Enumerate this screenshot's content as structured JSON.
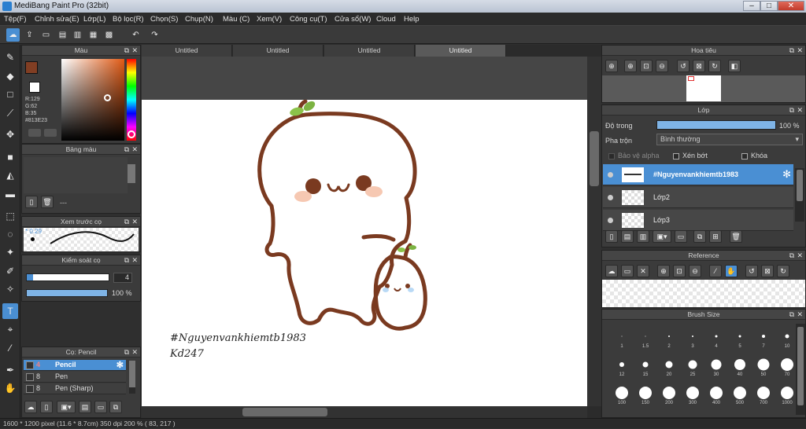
{
  "window": {
    "title": "MediBang Paint Pro (32bit)",
    "minimize": "–",
    "maximize": "□",
    "close": "✕"
  },
  "menu": [
    "Tệp(F)",
    "Chỉnh sửa(E)",
    "Lớp(L)",
    "Bộ lọc(R)",
    "Chọn(S)",
    "Chụp(N)",
    "Màu (C)",
    "Xem(V)",
    "Công cụ(T)",
    "Cửa sổ(W)",
    "Cloud",
    "Help"
  ],
  "tabs": [
    "Untitled",
    "Untitled",
    "Untitled",
    "Untitled"
  ],
  "color_panel": {
    "title": "Màu",
    "r": "R:129",
    "g": "G:62",
    "b": "B:35",
    "hex": "#813E23",
    "main_color": "#813E23"
  },
  "palette_panel": {
    "title": "Bảng màu",
    "dash": "---"
  },
  "brush_preview": {
    "title": "Xem trước cọ",
    "size_label": "0.29"
  },
  "brush_control": {
    "title": "Kiểm soát cọ",
    "size_value": "4",
    "opacity_value": "100 %",
    "size_fraction": 0.08,
    "opacity_fraction": 1.0
  },
  "brush_list": {
    "title": "Cọ: Pencil",
    "items": [
      {
        "size": "4",
        "name": "Pencil",
        "selected": true
      },
      {
        "size": "8",
        "name": "Pen",
        "selected": false
      },
      {
        "size": "8",
        "name": "Pen (Sharp)",
        "selected": false
      }
    ]
  },
  "canvas": {
    "watermark_line1": "#Nguyenvankhiemtb1983",
    "watermark_line2": "Kd247"
  },
  "navigator": {
    "title": "Hoa tiêu"
  },
  "layers": {
    "title": "Lớp",
    "opacity_label": "Độ trong",
    "opacity_value": "100 %",
    "opacity_fraction": 1.0,
    "blend_label": "Pha trộn",
    "blend_value": "Bình thường",
    "protect_alpha": "Bảo vệ alpha",
    "clip": "Xén bớt",
    "lock": "Khóa",
    "items": [
      {
        "name": "#Nguyenvankhiemtb1983",
        "selected": true
      },
      {
        "name": "Lớp2",
        "selected": false
      },
      {
        "name": "Lớp3",
        "selected": false
      }
    ]
  },
  "reference": {
    "title": "Reference"
  },
  "brush_size": {
    "title": "Brush Size",
    "row1": [
      "1",
      "1.5",
      "2",
      "3",
      "4",
      "5",
      "7",
      "10"
    ],
    "row2": [
      "12",
      "15",
      "20",
      "25",
      "30",
      "40",
      "50",
      "70"
    ],
    "row3": [
      "100",
      "150",
      "200",
      "300",
      "400",
      "500",
      "700",
      "1000"
    ]
  },
  "status": {
    "text": "1600 * 1200 pixel   (11.6 * 8.7cm)   350 dpi   200 %   ( 83, 217 )"
  },
  "icons": [
    "cloud-icon",
    "export-icon",
    "speech-icon",
    "document-icon",
    "grid-icon",
    "undo-icon",
    "redo-icon",
    "brush-icon",
    "eraser-icon",
    "rectangle-icon",
    "move-icon",
    "fill-icon",
    "gradient-icon",
    "select-icon",
    "lasso-icon",
    "magic-wand-icon",
    "text-icon",
    "hand-icon",
    "eyedropper-icon",
    "gear-icon",
    "zoom-in-icon",
    "zoom-out-icon",
    "folder-icon",
    "trash-icon"
  ]
}
